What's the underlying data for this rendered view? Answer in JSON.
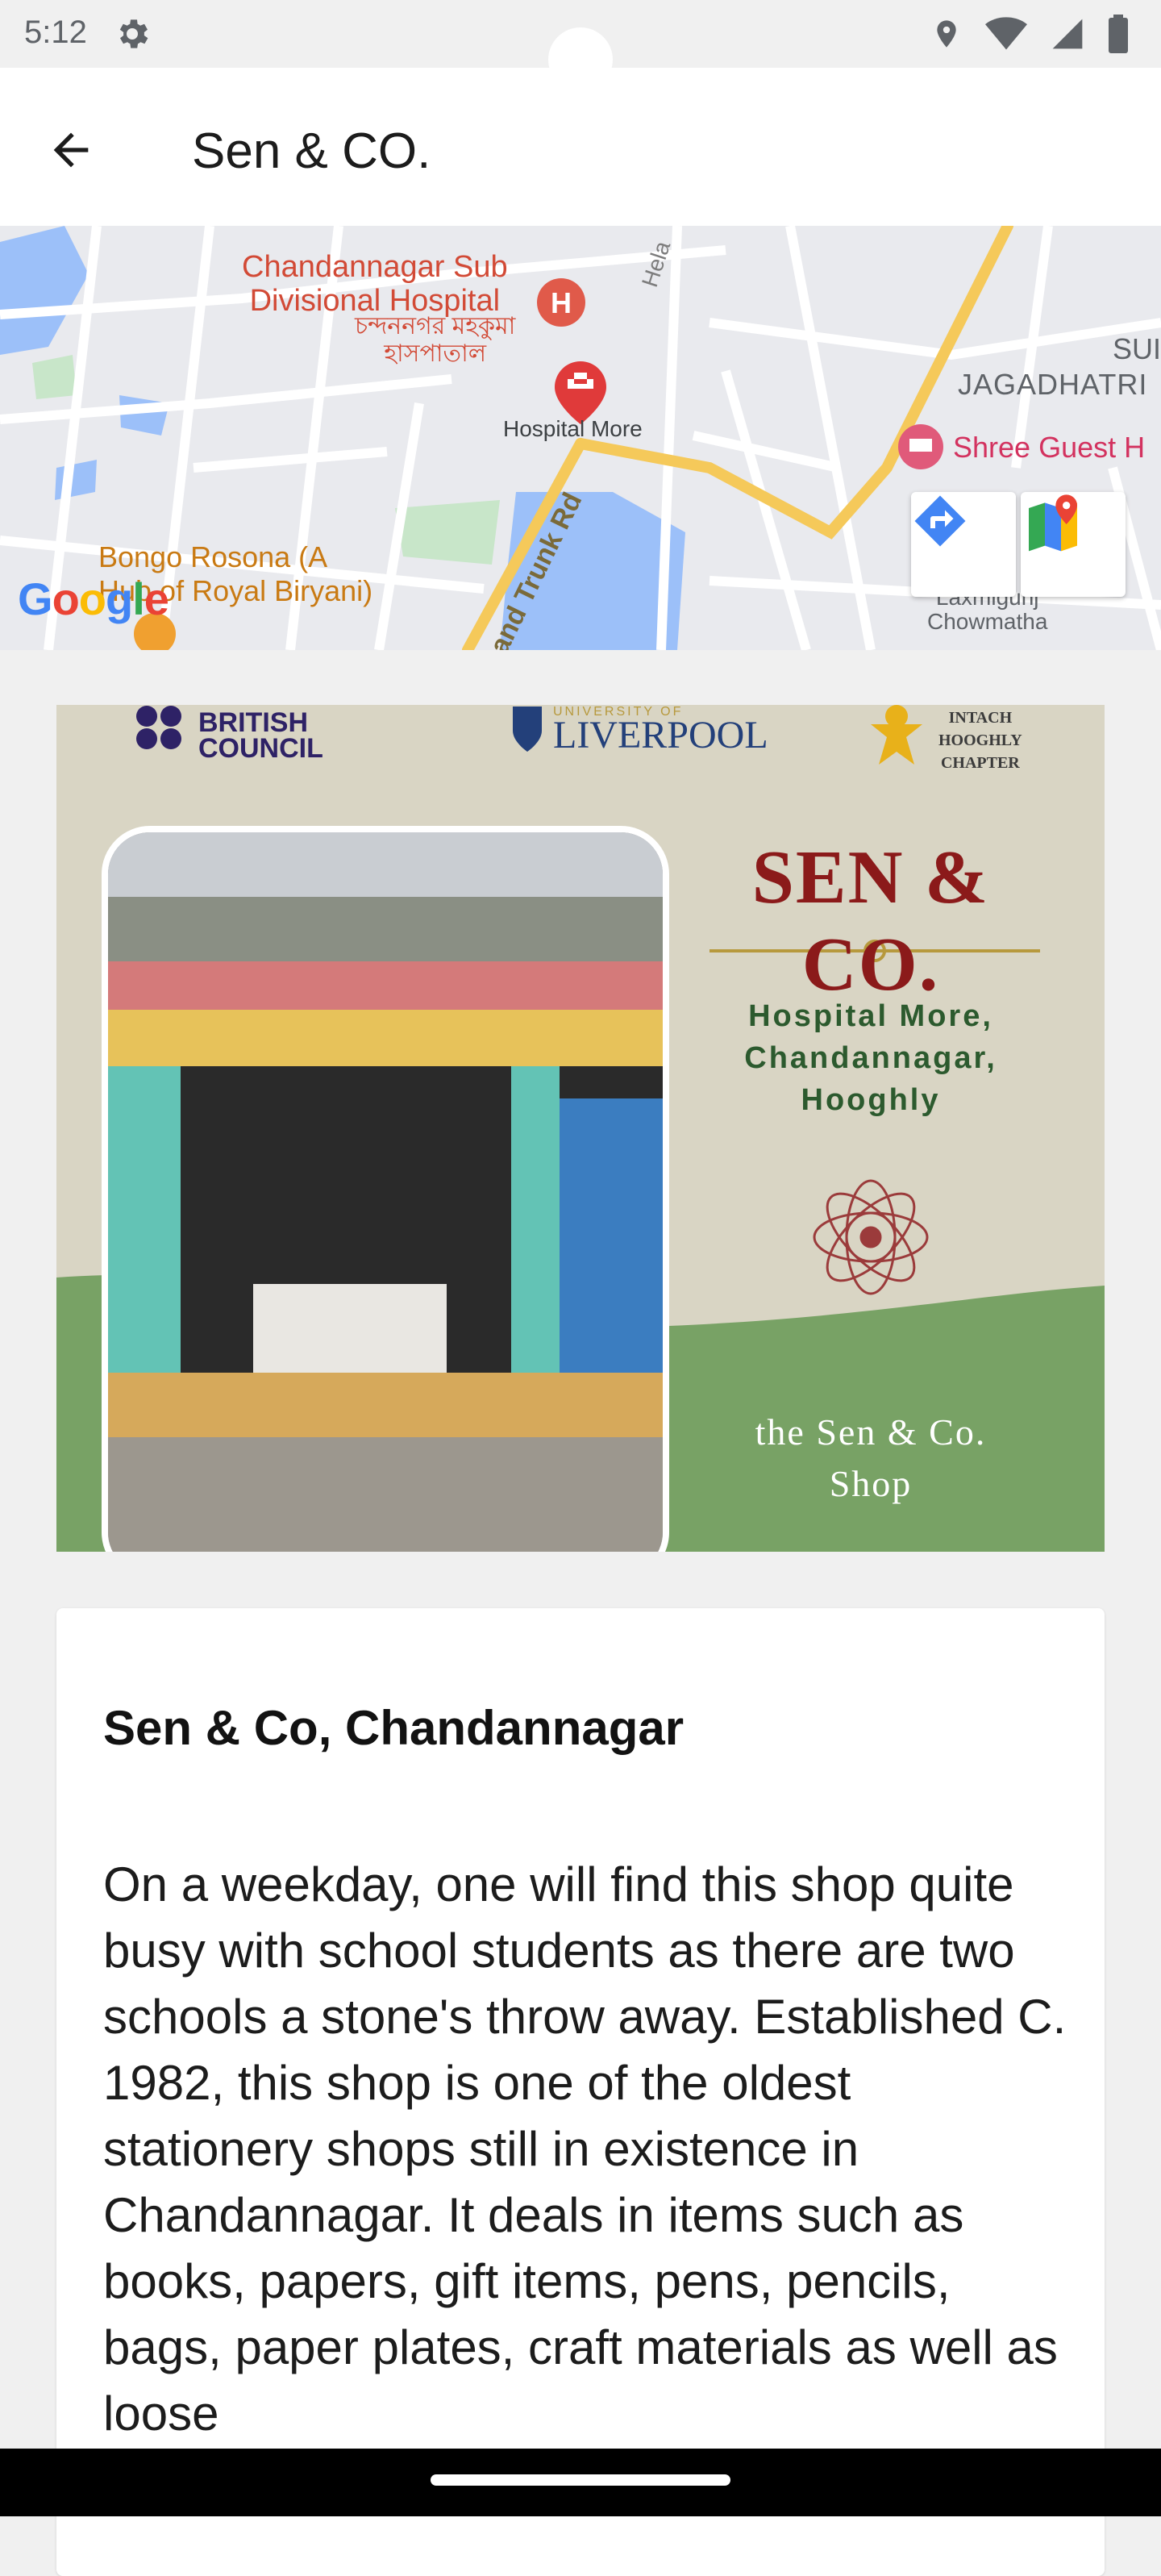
{
  "status_bar": {
    "time": "5:12",
    "icons": [
      "settings-icon",
      "location-icon",
      "wifi-icon",
      "signal-icon",
      "battery-icon"
    ]
  },
  "app_bar": {
    "back_icon": "arrow-back-icon",
    "title": "Sen & CO."
  },
  "map": {
    "labels": {
      "hospital_line1": "Chandannagar Sub",
      "hospital_line2": "Divisional Hospital",
      "hospital_bn_line1": "চন্দননগর মহকুমা",
      "hospital_bn_line2": "হাসপাতাল",
      "hospital_more": "Hospital More",
      "sup": "SUI",
      "jagadhatri": "JAGADHATRI",
      "shree": "Shree Guest H",
      "bongo_line1": "Bongo Rosona (A",
      "bongo_line2": "Hub of Royal Biryani)",
      "laxmi_line1": "Laxmigunj",
      "laxmi_line2": "Chowmatha",
      "road": "and Trunk Rd",
      "hela": "Hela"
    },
    "google_logo": "Google",
    "buttons": {
      "directions_icon": "directions-icon",
      "google_maps_icon": "google-maps-icon"
    },
    "colors": {
      "background": "#e9eaee",
      "road_major": "#f5c95a",
      "water": "#9cc0f9",
      "park": "#c8e6c9"
    }
  },
  "banner": {
    "logos": {
      "british_council_line1": "BRITISH",
      "british_council_line2": "COUNCIL",
      "liverpool_small": "UNIVERSITY OF",
      "liverpool": "LIVERPOOL",
      "intach_line1": "INTACH",
      "intach_line2": "HOOGHLY",
      "intach_line3": "CHAPTER"
    },
    "shop_name": "SEN & CO.",
    "address_line1": "Hospital More,",
    "address_line2": "Chandannagar,",
    "address_line3": "Hooghly",
    "caption_line1": "the Sen & Co.",
    "caption_line2": "Shop",
    "colors": {
      "cream": "#d9d5c4",
      "green": "#78a265",
      "maroon": "#8b1a1a",
      "gold": "#b7993d"
    }
  },
  "article": {
    "title": "Sen & Co, Chandannagar",
    "body": "On a weekday, one will find this shop quite busy with school students as there are two schools a stone's throw away. Established C. 1982, this shop is one of the oldest stationery shops still in existence in Chandannagar. It deals in items such as books, papers, gift items, pens, pencils, bags, paper plates, craft materials as well as loose"
  }
}
